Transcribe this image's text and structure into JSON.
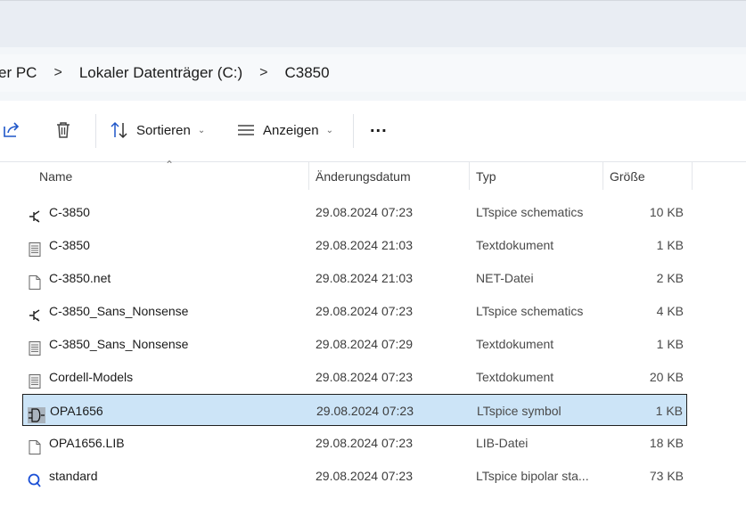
{
  "breadcrumb": {
    "items": [
      "er PC",
      "Lokaler Datenträger (C:)",
      "C3850"
    ],
    "separator": ">"
  },
  "toolbar": {
    "share_icon": "share-icon",
    "delete_icon": "trash-icon",
    "sort_label": "Sortieren",
    "view_label": "Anzeigen",
    "more_label": "..."
  },
  "columns": {
    "name": "Name",
    "date": "Änderungsdatum",
    "type": "Typ",
    "size": "Größe"
  },
  "files": [
    {
      "name": "C-3850",
      "date": "29.08.2024 07:23",
      "type": "LTspice schematics",
      "size": "10 KB",
      "icon": "ltspice-schematic-icon"
    },
    {
      "name": "C-3850",
      "date": "29.08.2024 21:03",
      "type": "Textdokument",
      "size": "1 KB",
      "icon": "text-document-icon"
    },
    {
      "name": "C-3850.net",
      "date": "29.08.2024 21:03",
      "type": "NET-Datei",
      "size": "2 KB",
      "icon": "blank-file-icon"
    },
    {
      "name": "C-3850_Sans_Nonsense",
      "date": "29.08.2024 07:23",
      "type": "LTspice schematics",
      "size": "4 KB",
      "icon": "ltspice-schematic-icon"
    },
    {
      "name": "C-3850_Sans_Nonsense",
      "date": "29.08.2024 07:29",
      "type": "Textdokument",
      "size": "1 KB",
      "icon": "text-document-icon"
    },
    {
      "name": "Cordell-Models",
      "date": "29.08.2024 07:23",
      "type": "Textdokument",
      "size": "20 KB",
      "icon": "text-document-icon"
    },
    {
      "name": "OPA1656",
      "date": "29.08.2024 07:23",
      "type": "LTspice symbol",
      "size": "1 KB",
      "icon": "ltspice-symbol-icon",
      "selected": true
    },
    {
      "name": "OPA1656.LIB",
      "date": "29.08.2024 07:23",
      "type": "LIB-Datei",
      "size": "18 KB",
      "icon": "blank-file-icon"
    },
    {
      "name": "standard",
      "date": "29.08.2024 07:23",
      "type": "LTspice bipolar sta...",
      "size": "73 KB",
      "icon": "ltspice-bipolar-icon"
    }
  ],
  "colors": {
    "selection": "#cce4f7",
    "toolbar_bg": "#ffffff",
    "address_bg": "#f3f6f9",
    "accent_blue": "#1a4fd6"
  }
}
